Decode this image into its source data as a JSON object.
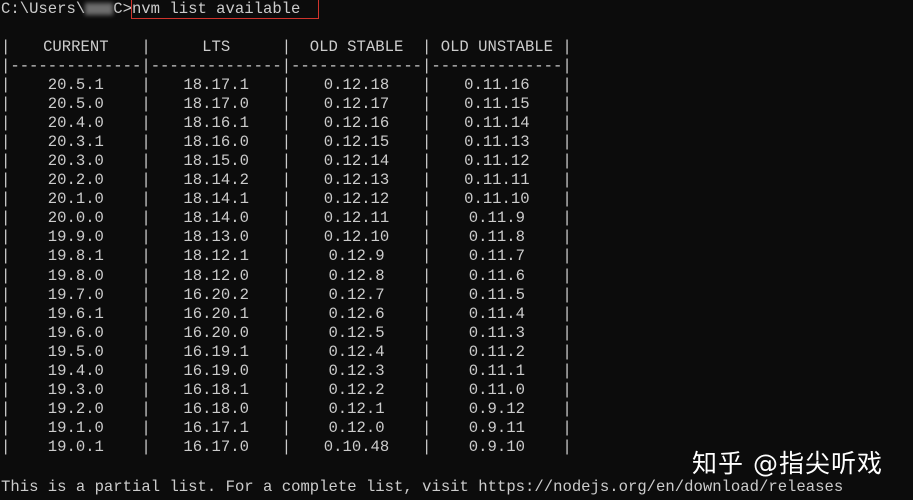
{
  "prompt": {
    "path_prefix": "C:\\Users\\",
    "path_suffix": "C>",
    "command": "nvm list available"
  },
  "table": {
    "headers": [
      "CURRENT",
      "LTS",
      "OLD STABLE",
      "OLD UNSTABLE"
    ],
    "separator": "--------------",
    "rows": [
      [
        "20.5.1",
        "18.17.1",
        "0.12.18",
        "0.11.16"
      ],
      [
        "20.5.0",
        "18.17.0",
        "0.12.17",
        "0.11.15"
      ],
      [
        "20.4.0",
        "18.16.1",
        "0.12.16",
        "0.11.14"
      ],
      [
        "20.3.1",
        "18.16.0",
        "0.12.15",
        "0.11.13"
      ],
      [
        "20.3.0",
        "18.15.0",
        "0.12.14",
        "0.11.12"
      ],
      [
        "20.2.0",
        "18.14.2",
        "0.12.13",
        "0.11.11"
      ],
      [
        "20.1.0",
        "18.14.1",
        "0.12.12",
        "0.11.10"
      ],
      [
        "20.0.0",
        "18.14.0",
        "0.12.11",
        "0.11.9"
      ],
      [
        "19.9.0",
        "18.13.0",
        "0.12.10",
        "0.11.8"
      ],
      [
        "19.8.1",
        "18.12.1",
        "0.12.9",
        "0.11.7"
      ],
      [
        "19.8.0",
        "18.12.0",
        "0.12.8",
        "0.11.6"
      ],
      [
        "19.7.0",
        "16.20.2",
        "0.12.7",
        "0.11.5"
      ],
      [
        "19.6.1",
        "16.20.1",
        "0.12.6",
        "0.11.4"
      ],
      [
        "19.6.0",
        "16.20.0",
        "0.12.5",
        "0.11.3"
      ],
      [
        "19.5.0",
        "16.19.1",
        "0.12.4",
        "0.11.2"
      ],
      [
        "19.4.0",
        "16.19.0",
        "0.12.3",
        "0.11.1"
      ],
      [
        "19.3.0",
        "16.18.1",
        "0.12.2",
        "0.11.0"
      ],
      [
        "19.2.0",
        "16.18.0",
        "0.12.1",
        "0.9.12"
      ],
      [
        "19.1.0",
        "16.17.1",
        "0.12.0",
        "0.9.11"
      ],
      [
        "19.0.1",
        "16.17.0",
        "0.10.48",
        "0.9.10"
      ]
    ]
  },
  "footer": "This is a partial list. For a complete list, visit https://nodejs.org/en/download/releases",
  "watermark": "知乎 @指尖听戏",
  "colors": {
    "background": "#0c0c0c",
    "text": "#cccccc",
    "highlight": "#d0342c"
  }
}
